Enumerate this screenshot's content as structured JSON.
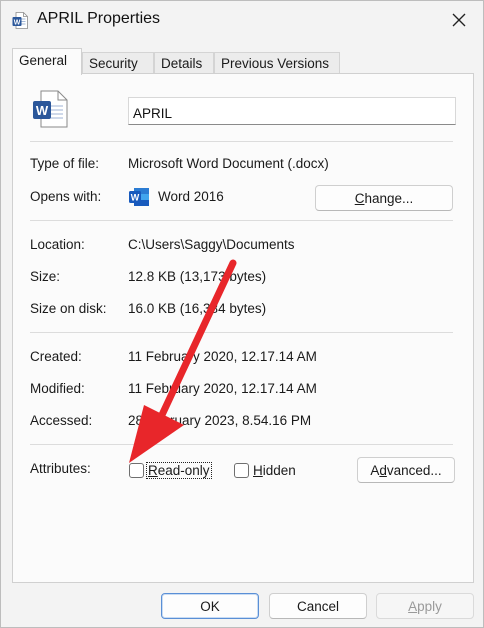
{
  "window": {
    "title": "APRIL Properties",
    "close_icon": "close-icon"
  },
  "tabs": [
    {
      "label": "General",
      "active": true
    },
    {
      "label": "Security",
      "active": false
    },
    {
      "label": "Details",
      "active": false
    },
    {
      "label": "Previous Versions",
      "active": false
    }
  ],
  "general": {
    "file_name": "APRIL",
    "type_of_file": {
      "label": "Type of file:",
      "value": "Microsoft Word Document (.docx)"
    },
    "opens_with": {
      "label": "Opens with:",
      "value": "Word 2016",
      "change_pre": "",
      "change_ul": "C",
      "change_post": "hange..."
    },
    "location": {
      "label": "Location:",
      "value": "C:\\Users\\Saggy\\Documents"
    },
    "size": {
      "label": "Size:",
      "value": "12.8 KB (13,173 bytes)"
    },
    "size_on_disk": {
      "label": "Size on disk:",
      "value": "16.0 KB (16,384 bytes)"
    },
    "created": {
      "label": "Created:",
      "value": "11 February 2020, 12.17.14 AM"
    },
    "modified": {
      "label": "Modified:",
      "value": "11 February 2020, 12.17.14 AM"
    },
    "accessed": {
      "label": "Accessed:",
      "value": "28 February 2023, 8.54.16 PM"
    },
    "attributes": {
      "label": "Attributes:",
      "read_only": {
        "ul": "R",
        "rest": "ead-only",
        "checked": false
      },
      "hidden": {
        "ul": "H",
        "rest": "idden",
        "checked": false
      },
      "advanced": {
        "pre": "A",
        "ul": "d",
        "post": "vanced..."
      }
    }
  },
  "footer": {
    "ok": "OK",
    "cancel": "Cancel",
    "apply_ul": "A",
    "apply_rest": "pply"
  },
  "colors": {
    "annotation_arrow": "#e8262a",
    "word_blue": "#2b579a",
    "accent_focus": "#5a8fd6"
  },
  "icons": {
    "title": "word-document-icon",
    "file": "word-document-large-icon",
    "opens_with": "word-app-icon"
  }
}
